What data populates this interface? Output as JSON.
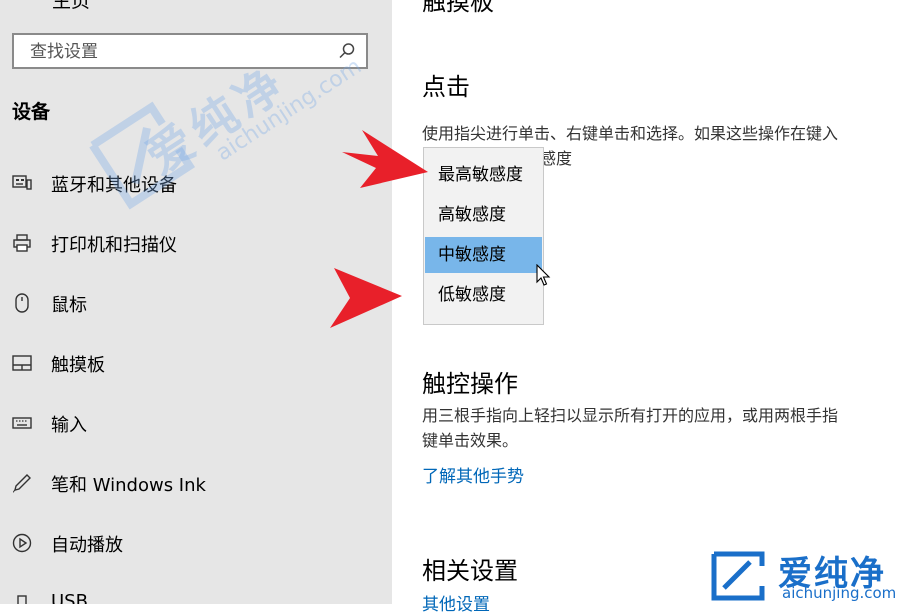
{
  "sidebar": {
    "top_cut_title": "主页",
    "search_placeholder": "查找设置",
    "section_title": "设备",
    "items": [
      {
        "label": "蓝牙和其他设备",
        "icon": "bluetooth-device-icon"
      },
      {
        "label": "打印机和扫描仪",
        "icon": "printer-icon"
      },
      {
        "label": "鼠标",
        "icon": "mouse-icon"
      },
      {
        "label": "触摸板",
        "icon": "touchpad-icon"
      },
      {
        "label": "输入",
        "icon": "keyboard-icon"
      },
      {
        "label": "笔和 Windows Ink",
        "icon": "pen-icon"
      },
      {
        "label": "自动播放",
        "icon": "autoplay-icon"
      },
      {
        "label": "USB",
        "icon": "usb-icon"
      }
    ]
  },
  "main": {
    "page_title": "触摸板",
    "tap": {
      "title": "点击",
      "desc_line1": "使用指尖进行单击、右键单击和选择。如果这些操作在键入",
      "desc_line2_tail": "感度"
    },
    "sensitivity_dropdown": {
      "options": [
        "最高敏感度",
        "高敏感度",
        "中敏感度",
        "低敏感度"
      ],
      "selected": "中敏感度"
    },
    "touch_gestures": {
      "title": "触控操作",
      "desc_line1": "用三根手指向上轻扫以显示所有打开的应用，或用两根手指",
      "desc_line2": "键单击效果。",
      "link": "了解其他手势"
    },
    "related": {
      "title": "相关设置",
      "link": "其他设置"
    }
  },
  "watermark": {
    "cn": "爱纯净",
    "en": "aichunjing.com"
  },
  "colors": {
    "sidebar_bg": "#e6e6e6",
    "selected_option": "#78b6ea",
    "link": "#0067b8",
    "annotation_arrow": "#e8202a"
  }
}
